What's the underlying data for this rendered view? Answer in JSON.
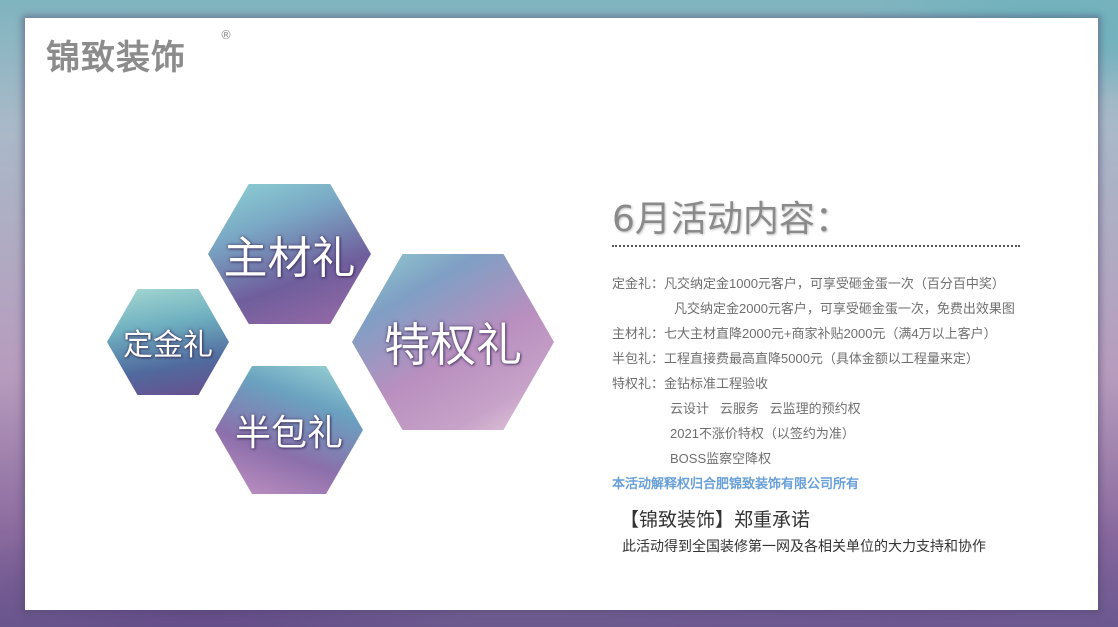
{
  "brand": {
    "name": "锦致装饰",
    "reg_mark": "®"
  },
  "hexagons": {
    "main_material": "主材礼",
    "deposit": "定金礼",
    "half_package": "半包礼",
    "privilege": "特权礼"
  },
  "activity": {
    "title": "6月活动内容：",
    "lines": [
      "定金礼：凡交纳定金1000元客户，可享受砸金蛋一次（百分百中奖）",
      "凡交纳定金2000元客户，可享受砸金蛋一次，免费出效果图",
      "主材礼：七大主材直降2000元+商家补贴2000元（满4万以上客户）",
      "半包礼：工程直接费最高直降5000元（具体金额以工程量来定）",
      "特权礼：金钻标准工程验收",
      "云设计   云服务   云监理的预约权",
      "2021不涨价特权（以签约为准）",
      "BOSS监察空降权"
    ],
    "copyright": "本活动解释权归合肥锦致装饰有限公司所有",
    "promise": "【锦致装饰】郑重承诺",
    "support": "此活动得到全国装修第一网及各相关单位的大力支持和协作"
  },
  "colors": {
    "copyright_blue": "#6aa0d8",
    "title_gray": "#8a8a8a",
    "logo_gray": "#8c8c8c"
  }
}
